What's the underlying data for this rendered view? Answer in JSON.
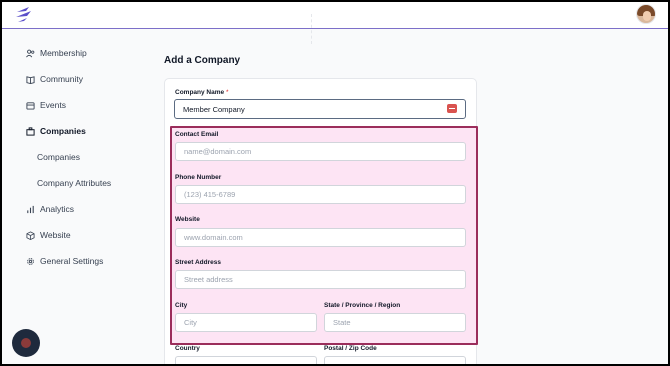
{
  "sidebar": {
    "items": [
      {
        "label": "Membership",
        "icon": "users-icon"
      },
      {
        "label": "Community",
        "icon": "book-icon"
      },
      {
        "label": "Events",
        "icon": "calendar-icon"
      },
      {
        "label": "Companies",
        "icon": "building-icon"
      },
      {
        "label": "Analytics",
        "icon": "bar-chart-icon"
      },
      {
        "label": "Website",
        "icon": "cube-icon"
      },
      {
        "label": "General Settings",
        "icon": "gear-icon"
      }
    ],
    "subitems": [
      "Companies",
      "Company Attributes"
    ]
  },
  "page": {
    "title": "Add a Company"
  },
  "form": {
    "company_name": {
      "label": "Company Name",
      "required": "*",
      "value": "Member Company"
    },
    "contact_email": {
      "label": "Contact Email",
      "placeholder": "name@domain.com"
    },
    "phone": {
      "label": "Phone Number",
      "placeholder": "(123) 415-6789"
    },
    "website": {
      "label": "Website",
      "placeholder": "www.domain.com"
    },
    "street": {
      "label": "Street Address",
      "placeholder": "Street address"
    },
    "city": {
      "label": "City",
      "placeholder": "City"
    },
    "state": {
      "label": "State / Province / Region",
      "placeholder": "State"
    },
    "country": {
      "label": "Country"
    },
    "postal": {
      "label": "Postal / Zip Code"
    }
  },
  "colors": {
    "accent": "#7c6fc9",
    "highlight_border": "#9b2d5b",
    "highlight_fill": "#fde4f4"
  }
}
